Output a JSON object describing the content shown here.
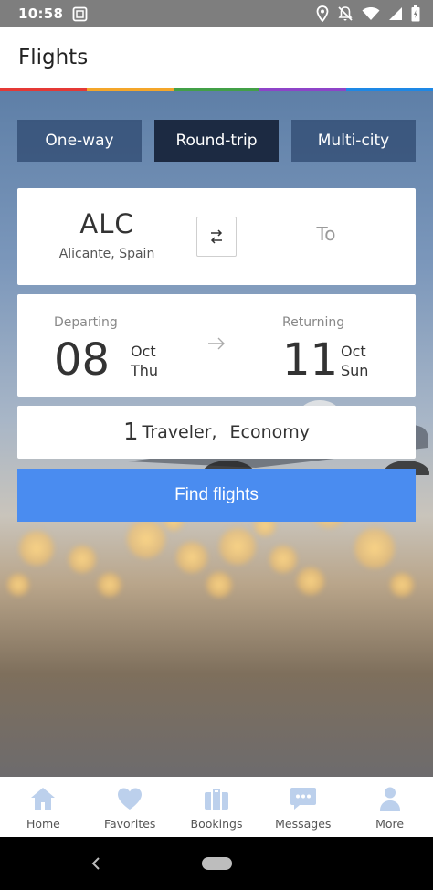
{
  "status_bar": {
    "time": "10:58"
  },
  "app": {
    "title": "Flights"
  },
  "colors": {
    "rainbow": [
      "#e53935",
      "#f4a62a",
      "#43a047",
      "#8e44c8",
      "#1e88e5"
    ],
    "accent": "#4a8cf0",
    "tab_active": "#1c2a42"
  },
  "trip_types": [
    {
      "label": "One-way",
      "active": false
    },
    {
      "label": "Round-trip",
      "active": true
    },
    {
      "label": "Multi-city",
      "active": false
    }
  ],
  "route": {
    "origin_code": "ALC",
    "origin_city": "Alicante, Spain",
    "destination_placeholder": "To",
    "swap_icon": "swap-icon"
  },
  "dates": {
    "departing_label": "Departing",
    "departing_day": "08",
    "departing_month": "Oct",
    "departing_weekday": "Thu",
    "returning_label": "Returning",
    "returning_day": "11",
    "returning_month": "Oct",
    "returning_weekday": "Sun"
  },
  "travelers": {
    "count": "1",
    "label": "Traveler,",
    "cabin": "Economy"
  },
  "search_button": {
    "label": "Find flights"
  },
  "bottom_nav": [
    {
      "label": "Home",
      "icon": "home-icon"
    },
    {
      "label": "Favorites",
      "icon": "heart-icon"
    },
    {
      "label": "Bookings",
      "icon": "briefcase-icon"
    },
    {
      "label": "Messages",
      "icon": "chat-icon"
    },
    {
      "label": "More",
      "icon": "person-icon"
    }
  ]
}
